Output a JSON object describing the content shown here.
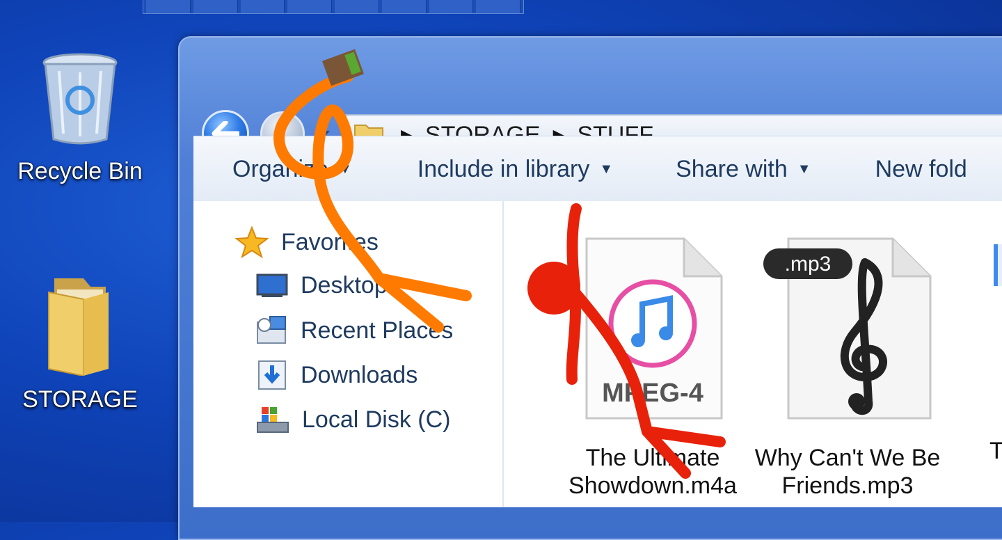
{
  "desktop": {
    "icons": [
      {
        "label": "Recycle Bin",
        "icon": "recycle-bin-icon"
      },
      {
        "label": "STORAGE",
        "icon": "folder-icon"
      }
    ]
  },
  "explorer": {
    "breadcrumb": [
      "STORAGE",
      "STUFF"
    ],
    "toolbar": {
      "organize": "Organize",
      "include_in_library": "Include in library",
      "share_with": "Share with",
      "new_folder": "New fold"
    },
    "nav": {
      "favorites": "Favorites",
      "items": [
        {
          "label": "Desktop",
          "icon": "desktop-icon"
        },
        {
          "label": "Recent Places",
          "icon": "recent-places-icon"
        },
        {
          "label": "Downloads",
          "icon": "downloads-icon"
        },
        {
          "label": "Local Disk (C)",
          "icon": "local-disk-icon"
        }
      ]
    },
    "files": [
      {
        "name_line1": "The Ultimate",
        "name_line2": "Showdown.m4a",
        "badge": "MPEG-4",
        "icon": "itunes-icon"
      },
      {
        "name_line1": "Why Can't We Be",
        "name_line2": "Friends.mp3",
        "badge": ".mp3",
        "icon": "treble-clef-icon"
      }
    ],
    "partial_next_label": "T"
  },
  "colors": {
    "desktop_blue": "#0f43b8",
    "orange_stick": "#ff7a00",
    "red_stick": "#e8220a"
  }
}
